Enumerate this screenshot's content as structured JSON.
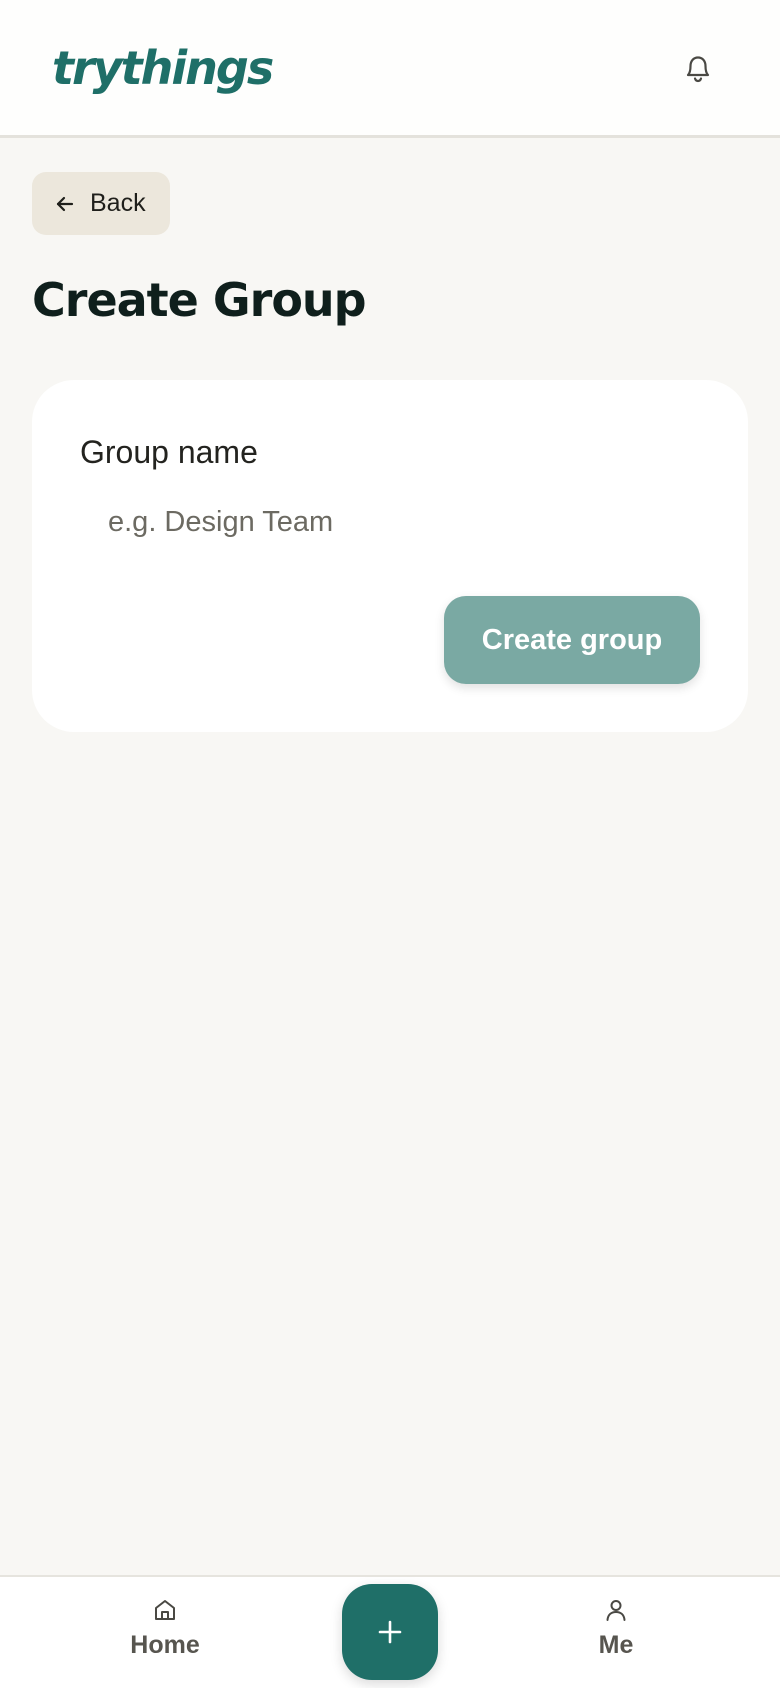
{
  "header": {
    "logo_text": "trythings",
    "bell_icon": "bell-icon"
  },
  "back": {
    "label": "Back",
    "icon": "arrow-left-icon"
  },
  "page": {
    "title": "Create Group"
  },
  "form": {
    "group_name_label": "Group name",
    "group_name_placeholder": "e.g. Design Team",
    "group_name_value": "",
    "submit_label": "Create group"
  },
  "bottom_nav": {
    "home_label": "Home",
    "home_icon": "home-icon",
    "add_icon": "plus-icon",
    "me_label": "Me",
    "me_icon": "user-icon"
  },
  "colors": {
    "brand": "#1f6f68",
    "button_disabled": "#7aa9a3",
    "background": "#f8f7f4",
    "back_button_bg": "#ece7dc"
  }
}
